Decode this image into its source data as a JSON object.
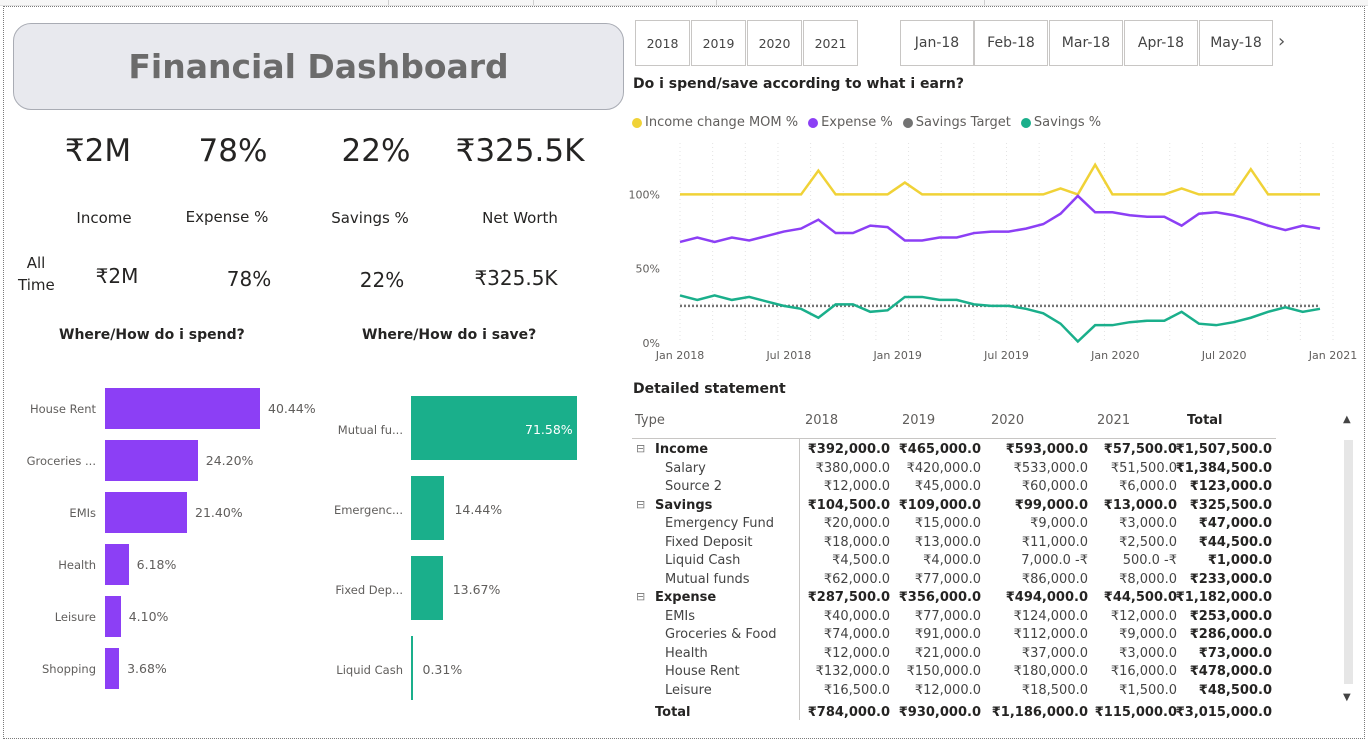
{
  "title": "Financial Dashboard",
  "kpis": {
    "income": "₹2M",
    "expense_pct": "78%",
    "savings_pct": "22%",
    "net_worth": "₹325.5K",
    "income_label": "Income",
    "expense_label": "Expense %",
    "savings_label": "Savings %",
    "net_worth_label": "Net Worth",
    "all_time_label_1": "All",
    "all_time_label_2": "Time",
    "all_income": "₹2M",
    "all_expense_pct": "78%",
    "all_savings_pct": "22%",
    "all_net_worth": "₹325.5K"
  },
  "year_slicer": [
    "2018",
    "2019",
    "2020",
    "2021"
  ],
  "month_slicer": [
    "Jan-18",
    "Feb-18",
    "Mar-18",
    "Apr-18",
    "May-18"
  ],
  "spend_chart": {
    "title": "Where/How do i spend?",
    "categories": [
      "House Rent",
      "Groceries ...",
      "EMIs",
      "Health",
      "Leisure",
      "Shopping"
    ],
    "values": [
      40.44,
      24.2,
      21.4,
      6.18,
      4.1,
      3.68
    ],
    "labels": [
      "40.44%",
      "24.20%",
      "21.40%",
      "6.18%",
      "4.10%",
      "3.68%"
    ],
    "color": "#8c3ff5"
  },
  "save_chart": {
    "title": "Where/How do i save?",
    "categories": [
      "Mutual fu...",
      "Emergenc...",
      "Fixed Dep...",
      "Liquid Cash"
    ],
    "values": [
      71.58,
      14.44,
      13.67,
      0.31
    ],
    "labels": [
      "71.58%",
      "14.44%",
      "13.67%",
      "0.31%"
    ],
    "color": "#1aaf8b"
  },
  "chart_data": {
    "type": "line",
    "title": "Do i spend/save according to what i earn?",
    "x_ticks": [
      "Jan 2018",
      "Jul 2018",
      "Jan 2019",
      "Jul 2019",
      "Jan 2020",
      "Jul 2020",
      "Jan 2021"
    ],
    "y_ticks": [
      "0%",
      "50%",
      "100%"
    ],
    "ylim": [
      0,
      140
    ],
    "series": [
      {
        "name": "Income change MOM %",
        "color": "#f0d237",
        "values": [
          100,
          100,
          100,
          100,
          100,
          100,
          100,
          100,
          100,
          100,
          116,
          100,
          100,
          100,
          100,
          100,
          108,
          100,
          100,
          100,
          100,
          100,
          100,
          100,
          100,
          100,
          100,
          100,
          100,
          100,
          100,
          100,
          100,
          100,
          100,
          100,
          100,
          100,
          100,
          100,
          100,
          100,
          100,
          100,
          100,
          100,
          104,
          100,
          100,
          100,
          100,
          100,
          100,
          100,
          100,
          100,
          100,
          100,
          100,
          100,
          117,
          100,
          100,
          100,
          100,
          100,
          100,
          100,
          100,
          100,
          100,
          100,
          100,
          100,
          100,
          100,
          100,
          100,
          100,
          100,
          100,
          100,
          100,
          100,
          100,
          100,
          100,
          100,
          100,
          100,
          100,
          100,
          100,
          100,
          100,
          100,
          100,
          100,
          100,
          100,
          100,
          100,
          100,
          100,
          100,
          100,
          100,
          100,
          100,
          100,
          100,
          100,
          100,
          100,
          100,
          100,
          100,
          100,
          100,
          100,
          100,
          100,
          100,
          100,
          100,
          100,
          100,
          100,
          100,
          100,
          100,
          100,
          100,
          100,
          100,
          100,
          100,
          100,
          100,
          100,
          100,
          100,
          100,
          100,
          100,
          100,
          100,
          100,
          100,
          100
        ]
      },
      {
        "name": "Expense %",
        "color": "#8c3ff5",
        "values": [
          68,
          71,
          68,
          71,
          69,
          72,
          75,
          77,
          83,
          74,
          74,
          79,
          78,
          69,
          69,
          71,
          71,
          74,
          75,
          75,
          77,
          80,
          87,
          99,
          88,
          88,
          86,
          85,
          85,
          79,
          87,
          88,
          86,
          83,
          79,
          76,
          79,
          77
        ]
      },
      {
        "name": "Savings Target",
        "color": "#737373",
        "values": [
          25,
          25,
          25,
          25,
          25,
          25,
          25,
          25,
          25,
          25,
          25,
          25,
          25,
          25,
          25,
          25,
          25,
          25,
          25,
          25,
          25,
          25,
          25,
          25,
          25,
          25,
          25,
          25,
          25,
          25,
          25,
          25,
          25,
          25,
          25,
          25,
          25,
          25
        ]
      },
      {
        "name": "Savings %",
        "color": "#1aaf8b",
        "values": [
          32,
          29,
          32,
          29,
          31,
          28,
          25,
          23,
          17,
          26,
          26,
          21,
          22,
          31,
          31,
          29,
          29,
          26,
          25,
          25,
          23,
          20,
          13,
          1,
          12,
          12,
          14,
          15,
          15,
          21,
          13,
          12,
          14,
          17,
          21,
          24,
          21,
          23
        ]
      }
    ],
    "legend": "top"
  },
  "statement": {
    "title": "Detailed statement",
    "headers": [
      "Type",
      "2018",
      "2019",
      "2020",
      "2021",
      "Total"
    ],
    "rows": [
      {
        "type": "Income",
        "level": 0,
        "vals": [
          "₹392,000.0",
          "₹465,000.0",
          "₹593,000.0",
          "₹57,500.0",
          "₹1,507,500.0"
        ]
      },
      {
        "type": "Salary",
        "level": 1,
        "vals": [
          "₹380,000.0",
          "₹420,000.0",
          "₹533,000.0",
          "₹51,500.0",
          "₹1,384,500.0"
        ]
      },
      {
        "type": "Source 2",
        "level": 1,
        "vals": [
          "₹12,000.0",
          "₹45,000.0",
          "₹60,000.0",
          "₹6,000.0",
          "₹123,000.0"
        ]
      },
      {
        "type": "Savings",
        "level": 0,
        "vals": [
          "₹104,500.0",
          "₹109,000.0",
          "₹99,000.0",
          "₹13,000.0",
          "₹325,500.0"
        ]
      },
      {
        "type": "Emergency Fund",
        "level": 1,
        "vals": [
          "₹20,000.0",
          "₹15,000.0",
          "₹9,000.0",
          "₹3,000.0",
          "₹47,000.0"
        ]
      },
      {
        "type": "Fixed Deposit",
        "level": 1,
        "vals": [
          "₹18,000.0",
          "₹13,000.0",
          "₹11,000.0",
          "₹2,500.0",
          "₹44,500.0"
        ]
      },
      {
        "type": "Liquid Cash",
        "level": 1,
        "vals": [
          "₹4,500.0",
          "₹4,000.0",
          "7,000.0 -₹",
          "500.0 -₹",
          "₹1,000.0"
        ]
      },
      {
        "type": "Mutual funds",
        "level": 1,
        "vals": [
          "₹62,000.0",
          "₹77,000.0",
          "₹86,000.0",
          "₹8,000.0",
          "₹233,000.0"
        ]
      },
      {
        "type": "Expense",
        "level": 0,
        "vals": [
          "₹287,500.0",
          "₹356,000.0",
          "₹494,000.0",
          "₹44,500.0",
          "₹1,182,000.0"
        ]
      },
      {
        "type": "EMIs",
        "level": 1,
        "vals": [
          "₹40,000.0",
          "₹77,000.0",
          "₹124,000.0",
          "₹12,000.0",
          "₹253,000.0"
        ]
      },
      {
        "type": "Groceries & Food",
        "level": 1,
        "vals": [
          "₹74,000.0",
          "₹91,000.0",
          "₹112,000.0",
          "₹9,000.0",
          "₹286,000.0"
        ]
      },
      {
        "type": "Health",
        "level": 1,
        "vals": [
          "₹12,000.0",
          "₹21,000.0",
          "₹37,000.0",
          "₹3,000.0",
          "₹73,000.0"
        ]
      },
      {
        "type": "House Rent",
        "level": 1,
        "vals": [
          "₹132,000.0",
          "₹150,000.0",
          "₹180,000.0",
          "₹16,000.0",
          "₹478,000.0"
        ]
      },
      {
        "type": "Leisure",
        "level": 1,
        "vals": [
          "₹16,500.0",
          "₹12,000.0",
          "₹18,500.0",
          "₹1,500.0",
          "₹48,500.0"
        ]
      }
    ],
    "total": {
      "type": "Total",
      "vals": [
        "₹784,000.0",
        "₹930,000.0",
        "₹1,186,000.0",
        "₹115,000.0",
        "₹3,015,000.0"
      ]
    },
    "expander_symbol": "⊟"
  }
}
